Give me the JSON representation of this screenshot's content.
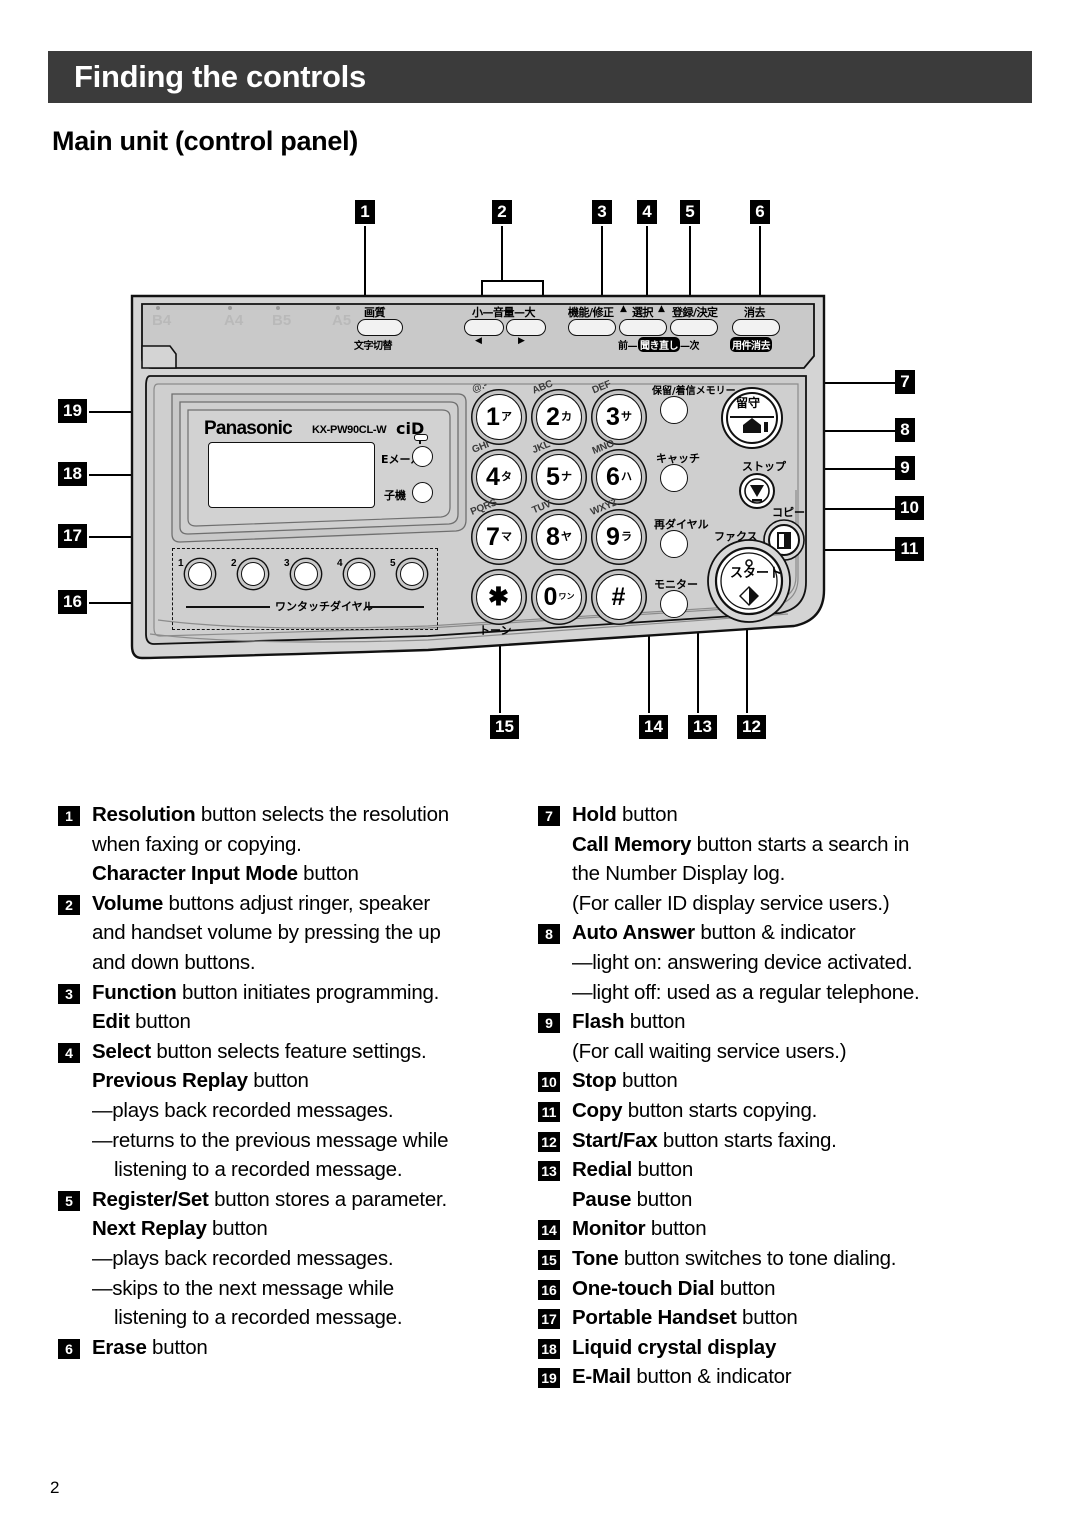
{
  "header": {
    "title": "Finding the controls",
    "section_title": "Main unit (control panel)"
  },
  "page": {
    "number": "2"
  },
  "device": {
    "brand": "Panasonic",
    "model": "KX-PW90CL-W",
    "cid_logo": "ciD",
    "paper_indicators": [
      "B4",
      "A4",
      "B5",
      "A5"
    ],
    "top_buttons": [
      {
        "top_label": "画質",
        "bottom_label": "文字切替"
      },
      {
        "top_label": "小—音量—大",
        "bottom_label": ""
      },
      {
        "top_label": "機能/修正",
        "bottom_label": ""
      },
      {
        "top_label": "選択",
        "bottom_label": ""
      },
      {
        "top_label": "登録/決定",
        "bottom_label": ""
      },
      {
        "top_label": "消去",
        "bottom_label": "用件消去"
      }
    ],
    "replay_strip": {
      "prev": "前—",
      "center": "聞き直し",
      "next": "—次"
    },
    "erase_strip": "用件消去",
    "side_buttons": [
      {
        "label": "Eメール"
      },
      {
        "label": "子機"
      }
    ],
    "function_buttons": [
      {
        "label": "保留/着信メモリー"
      },
      {
        "label": "キャッチ"
      },
      {
        "label": "再ダイヤル"
      },
      {
        "label": "モニター"
      }
    ],
    "action_buttons": [
      {
        "label": "留守"
      },
      {
        "label": "ストップ"
      },
      {
        "label": "コピー"
      },
      {
        "label": "ファクス"
      },
      {
        "label": "スタート"
      }
    ],
    "keypad": [
      {
        "num": "1",
        "kana": "ア",
        "abc": "@.-"
      },
      {
        "num": "2",
        "kana": "カ",
        "abc": "ABC"
      },
      {
        "num": "3",
        "kana": "サ",
        "abc": "DEF"
      },
      {
        "num": "4",
        "kana": "タ",
        "abc": "GHI"
      },
      {
        "num": "5",
        "kana": "ナ",
        "abc": "JKL"
      },
      {
        "num": "6",
        "kana": "ハ",
        "abc": "MNO"
      },
      {
        "num": "7",
        "kana": "マ",
        "abc": "PQRS"
      },
      {
        "num": "8",
        "kana": "ヤ",
        "abc": "TUV"
      },
      {
        "num": "9",
        "kana": "ラ",
        "abc": "WXYZ"
      },
      {
        "num": "✱",
        "kana": "",
        "abc": ""
      },
      {
        "num": "0",
        "kana": "ワン",
        "abc": ""
      },
      {
        "num": "#",
        "kana": "",
        "abc": ""
      }
    ],
    "tone_label": "トーン",
    "onetouch": {
      "label": "ワンタッチダイヤル",
      "numbers": [
        "1",
        "2",
        "3",
        "4",
        "5"
      ]
    }
  },
  "callouts": {
    "top": [
      "1",
      "2",
      "3",
      "4",
      "5",
      "6"
    ],
    "right": [
      "7",
      "8",
      "9",
      "10",
      "11"
    ],
    "bottom": [
      "15",
      "14",
      "13",
      "12"
    ],
    "left": [
      "19",
      "18",
      "17",
      "16"
    ]
  },
  "descriptions": {
    "left": [
      {
        "num": "1",
        "lines": [
          {
            "type": "main",
            "bold": "Resolution",
            "rest": " button selects the resolution"
          },
          {
            "type": "cont",
            "text": "when faxing or copying."
          },
          {
            "type": "cont-bold",
            "bold": "Character Input Mode",
            "rest": " button"
          }
        ]
      },
      {
        "num": "2",
        "lines": [
          {
            "type": "main",
            "bold": "Volume",
            "rest": " buttons adjust ringer, speaker"
          },
          {
            "type": "cont",
            "text": "and handset volume by pressing the up"
          },
          {
            "type": "cont",
            "text": "and down buttons."
          }
        ]
      },
      {
        "num": "3",
        "lines": [
          {
            "type": "main",
            "bold": "Function",
            "rest": " button initiates programming."
          },
          {
            "type": "cont-bold",
            "bold": "Edit",
            "rest": " button"
          }
        ]
      },
      {
        "num": "4",
        "lines": [
          {
            "type": "main",
            "bold": "Select",
            "rest": " button selects feature settings."
          },
          {
            "type": "cont-bold",
            "bold": "Previous Replay",
            "rest": " button"
          },
          {
            "type": "cont",
            "text": "—plays back recorded messages."
          },
          {
            "type": "cont",
            "text": "—returns to the previous message while"
          },
          {
            "type": "cont2",
            "text": "listening to a recorded message."
          }
        ]
      },
      {
        "num": "5",
        "lines": [
          {
            "type": "main",
            "bold": "Register/Set",
            "rest": " button stores a parameter."
          },
          {
            "type": "cont-bold",
            "bold": "Next Replay",
            "rest": " button"
          },
          {
            "type": "cont",
            "text": "—plays back recorded messages."
          },
          {
            "type": "cont",
            "text": "—skips to the next message while"
          },
          {
            "type": "cont2",
            "text": "listening to a recorded message."
          }
        ]
      },
      {
        "num": "6",
        "lines": [
          {
            "type": "main",
            "bold": "Erase",
            "rest": " button"
          }
        ]
      }
    ],
    "right": [
      {
        "num": "7",
        "lines": [
          {
            "type": "main",
            "bold": "Hold",
            "rest": " button"
          },
          {
            "type": "cont-bold",
            "bold": "Call Memory",
            "rest": " button starts a search in"
          },
          {
            "type": "cont",
            "text": "the Number Display log."
          },
          {
            "type": "cont",
            "text": "(For caller ID display service users.)"
          }
        ]
      },
      {
        "num": "8",
        "lines": [
          {
            "type": "main",
            "bold": "Auto Answer",
            "rest": " button & indicator"
          },
          {
            "type": "cont",
            "text": "—light on:  answering device activated."
          },
          {
            "type": "cont",
            "text": "—light off:  used as a regular telephone."
          }
        ]
      },
      {
        "num": "9",
        "lines": [
          {
            "type": "main",
            "bold": "Flash",
            "rest": " button"
          },
          {
            "type": "cont",
            "text": "(For call waiting service users.)"
          }
        ]
      },
      {
        "num": "10",
        "lines": [
          {
            "type": "main",
            "bold": "Stop",
            "rest": " button"
          }
        ]
      },
      {
        "num": "11",
        "lines": [
          {
            "type": "main",
            "bold": "Copy",
            "rest": " button starts copying."
          }
        ]
      },
      {
        "num": "12",
        "lines": [
          {
            "type": "main",
            "bold": "Start/Fax",
            "rest": " button starts faxing."
          }
        ]
      },
      {
        "num": "13",
        "lines": [
          {
            "type": "main",
            "bold": "Redial",
            "rest": " button"
          },
          {
            "type": "cont-bold",
            "bold": "Pause",
            "rest": " button"
          }
        ]
      },
      {
        "num": "14",
        "lines": [
          {
            "type": "main",
            "bold": "Monitor",
            "rest": " button"
          }
        ]
      },
      {
        "num": "15",
        "lines": [
          {
            "type": "main",
            "bold": "Tone",
            "rest": " button switches to tone dialing."
          }
        ]
      },
      {
        "num": "16",
        "lines": [
          {
            "type": "main",
            "bold": "One-touch Dial",
            "rest": " button"
          }
        ]
      },
      {
        "num": "17",
        "lines": [
          {
            "type": "main",
            "bold": "Portable Handset",
            "rest": " button"
          }
        ]
      },
      {
        "num": "18",
        "lines": [
          {
            "type": "main",
            "bold": "Liquid crystal display",
            "rest": ""
          }
        ]
      },
      {
        "num": "19",
        "lines": [
          {
            "type": "main",
            "bold": "E-Mail",
            "rest": " button & indicator"
          }
        ]
      }
    ]
  },
  "colors": {
    "header_bg": "#3b3b3b",
    "device_case": "#d6d6d6",
    "device_panel": "#cfcfcf",
    "ink": "#000000"
  }
}
